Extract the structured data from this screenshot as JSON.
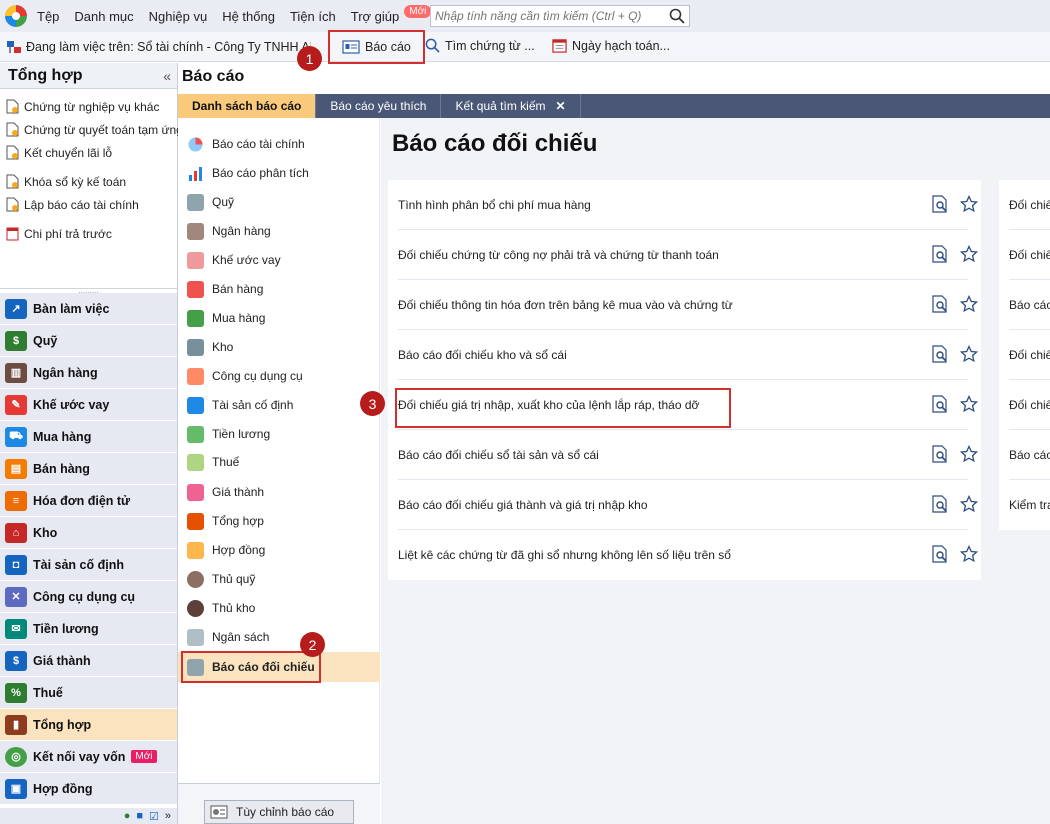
{
  "menu": {
    "items": [
      "Tệp",
      "Danh mục",
      "Nghiệp vụ",
      "Hệ thống",
      "Tiện ích",
      "Trợ giúp"
    ],
    "new_badge": "Mới",
    "search_placeholder": "Nhập tính năng cần tìm kiếm (Ctrl + Q)"
  },
  "toolbar": {
    "context": "Đang làm việc trên: Sổ tài chính - Công Ty TNHH ABC",
    "report_btn": "Báo cáo",
    "find_btn": "Tìm chứng từ ...",
    "date_btn": "Ngày hạch toán..."
  },
  "left_panel": {
    "title": "Tổng hợp",
    "collapse": "«",
    "links": [
      "Chứng từ nghiệp vụ khác",
      "Chứng từ quyết toán tạm ứng",
      "Kết chuyển lãi lỗ",
      "Khóa sổ kỳ kế toán",
      "Lập báo cáo tài chính",
      "Chi phí trả trước"
    ],
    "nav": [
      "Bàn làm việc",
      "Quỹ",
      "Ngân hàng",
      "Khế ước vay",
      "Mua hàng",
      "Bán hàng",
      "Hóa đơn điện tử",
      "Kho",
      "Tài sản cố định",
      "Công cụ dụng cụ",
      "Tiền lương",
      "Giá thành",
      "Thuế",
      "Tổng hợp",
      "Kết nối vay vốn",
      "Hợp đồng"
    ],
    "nav_badge": "Mới",
    "more": "»"
  },
  "content": {
    "title": "Báo cáo",
    "tabs": [
      "Danh sách báo cáo",
      "Báo cáo yêu thích",
      "Kết quả tìm kiếm"
    ],
    "tab_close": "✕"
  },
  "categories": {
    "items": [
      "Báo cáo tài chính",
      "Báo cáo phân tích",
      "Quỹ",
      "Ngân hàng",
      "Khế ước vay",
      "Bán hàng",
      "Mua hàng",
      "Kho",
      "Công cụ dụng cụ",
      "Tài sản cố định",
      "Tiền lương",
      "Thuế",
      "Giá thành",
      "Tổng hợp",
      "Hợp đồng",
      "Thủ quỹ",
      "Thủ kho",
      "Ngân sách",
      "Báo cáo đối chiếu"
    ],
    "custom_btn": "Tùy chỉnh báo cáo"
  },
  "main": {
    "title": "Báo cáo đối chiếu",
    "reports": [
      "Tình hình phân bổ chi phí mua hàng",
      "Đối chiếu chứng từ công nợ phải trả và chứng từ thanh toán",
      "Đối chiếu thông tin hóa đơn trên bảng kê mua vào và chứng từ",
      "Báo cáo đối chiếu kho và sổ cái",
      "Đối chiếu giá trị nhập, xuất kho của lệnh lắp ráp, tháo dỡ",
      "Báo cáo đối chiếu sổ tài sản và sổ cái",
      "Báo cáo đối chiếu giá thành và giá trị nhập kho",
      "Liệt kê các chứng từ đã ghi sổ nhưng không lên số liệu trên sổ"
    ],
    "reports_col2": [
      "Đối chiế",
      "Đối chiế",
      "Báo cáo",
      "Đối chiế",
      "Đối chiế",
      "Báo cáo",
      "Kiểm tra"
    ]
  },
  "markers": [
    "1",
    "2",
    "3"
  ],
  "colors": {
    "highlight": "#d32f2f",
    "active_bg": "#fbe3bf",
    "tab_bar": "#4a5777",
    "tab_active": "#f9c97c",
    "marker": "#b71c1c"
  }
}
